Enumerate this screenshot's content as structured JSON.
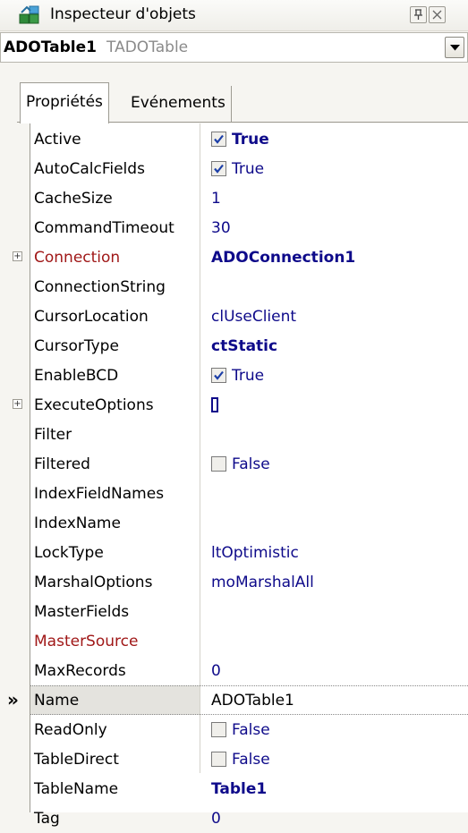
{
  "window": {
    "title": "Inspecteur d'objets"
  },
  "selector": {
    "component_name": "ADOTable1",
    "component_type": "TADOTable"
  },
  "tabs": [
    {
      "label": "Propriétés",
      "active": true
    },
    {
      "label": "Evénements",
      "active": false
    }
  ],
  "properties": [
    {
      "name": "Active",
      "value": "True",
      "kind": "checkbox",
      "checked": true,
      "bold": true
    },
    {
      "name": "AutoCalcFields",
      "value": "True",
      "kind": "checkbox",
      "checked": true,
      "bold": false
    },
    {
      "name": "CacheSize",
      "value": "1",
      "kind": "text",
      "bold": false
    },
    {
      "name": "CommandTimeout",
      "value": "30",
      "kind": "text",
      "bold": false
    },
    {
      "name": "Connection",
      "value": "ADOConnection1",
      "kind": "text",
      "bold": true,
      "expandable": true,
      "reference": true
    },
    {
      "name": "ConnectionString",
      "value": "",
      "kind": "text",
      "bold": false
    },
    {
      "name": "CursorLocation",
      "value": "clUseClient",
      "kind": "text",
      "bold": false
    },
    {
      "name": "CursorType",
      "value": "ctStatic",
      "kind": "text",
      "bold": true
    },
    {
      "name": "EnableBCD",
      "value": "True",
      "kind": "checkbox",
      "checked": true,
      "bold": false
    },
    {
      "name": "ExecuteOptions",
      "value": "",
      "kind": "set",
      "bold": false,
      "expandable": true
    },
    {
      "name": "Filter",
      "value": "",
      "kind": "text",
      "bold": false
    },
    {
      "name": "Filtered",
      "value": "False",
      "kind": "checkbox",
      "checked": false,
      "bold": false
    },
    {
      "name": "IndexFieldNames",
      "value": "",
      "kind": "text",
      "bold": false
    },
    {
      "name": "IndexName",
      "value": "",
      "kind": "text",
      "bold": false
    },
    {
      "name": "LockType",
      "value": "ltOptimistic",
      "kind": "text",
      "bold": false
    },
    {
      "name": "MarshalOptions",
      "value": "moMarshalAll",
      "kind": "text",
      "bold": false
    },
    {
      "name": "MasterFields",
      "value": "",
      "kind": "text",
      "bold": false
    },
    {
      "name": "MasterSource",
      "value": "",
      "kind": "text",
      "bold": false,
      "reference": true
    },
    {
      "name": "MaxRecords",
      "value": "0",
      "kind": "text",
      "bold": false
    },
    {
      "name": "Name",
      "value": "ADOTable1",
      "kind": "text",
      "bold": false,
      "selected": true
    },
    {
      "name": "ReadOnly",
      "value": "False",
      "kind": "checkbox",
      "checked": false,
      "bold": false
    },
    {
      "name": "TableDirect",
      "value": "False",
      "kind": "checkbox",
      "checked": false,
      "bold": false
    },
    {
      "name": "TableName",
      "value": "Table1",
      "kind": "text",
      "bold": true
    },
    {
      "name": "Tag",
      "value": "0",
      "kind": "text",
      "bold": false
    }
  ],
  "colors": {
    "value_text": "#0e0a8a",
    "reference_name": "#a01818",
    "selected_row": "#e4e3de"
  },
  "icons": {
    "app": "object-inspector-icon",
    "pin": "pin-icon",
    "close": "close-icon",
    "dropdown": "chevron-down-icon",
    "expand": "plus-expand-icon",
    "marker": "double-chevron-right-icon"
  }
}
